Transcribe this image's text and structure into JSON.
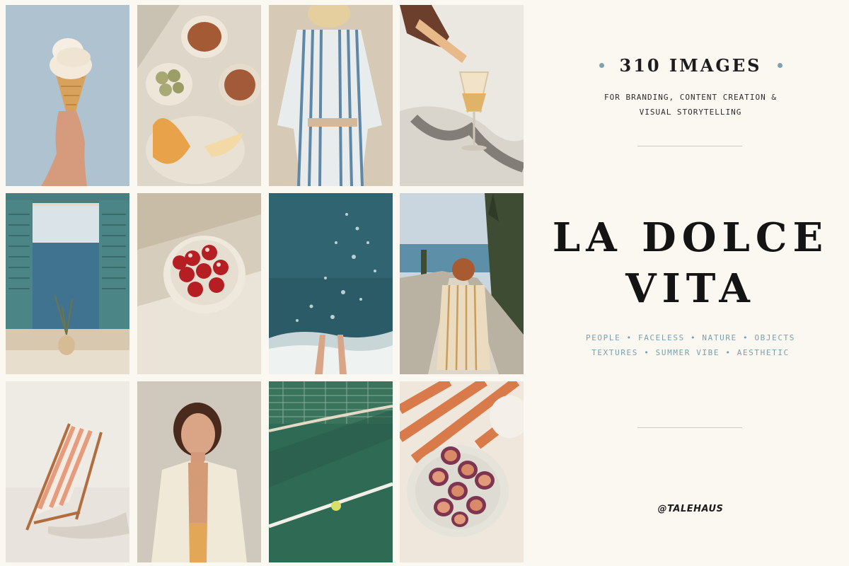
{
  "panel": {
    "image_count": "310 IMAGES",
    "subtitle_lines": [
      "FOR BRANDING, CONTENT CREATION &",
      "VISUAL STORYTELLING"
    ],
    "title_lines": [
      "LA DOLCE",
      "VITA"
    ],
    "tag_lines": [
      "PEOPLE • FACELESS • NATURE • OBJECTS",
      "TEXTURES • SUMMER VIBE • AESTHETIC"
    ],
    "handle": "@TALEHAUS"
  },
  "colors": {
    "background": "#fbf7f1",
    "accent_blue": "#7fa2b0",
    "title": "#141414"
  },
  "photos": [
    {
      "subject": "ice-cream-cone"
    },
    {
      "subject": "snack-bowls"
    },
    {
      "subject": "striped-shirt-person"
    },
    {
      "subject": "wine-pour"
    },
    {
      "subject": "window-sea-view"
    },
    {
      "subject": "cherry-bowl"
    },
    {
      "subject": "sea-water"
    },
    {
      "subject": "woman-on-path"
    },
    {
      "subject": "beach-chair"
    },
    {
      "subject": "woman-portrait"
    },
    {
      "subject": "tennis-court"
    },
    {
      "subject": "figs-plate"
    }
  ]
}
